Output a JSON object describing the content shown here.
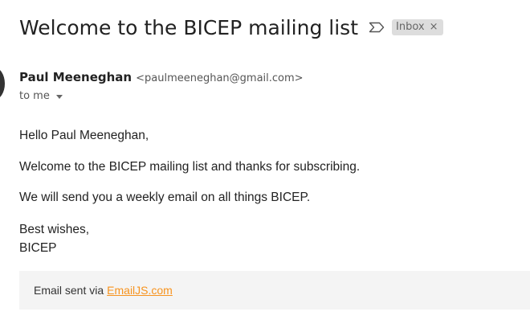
{
  "email": {
    "subject": "Welcome to the BICEP mailing list",
    "label_chip": "Inbox",
    "label_chip_close": "×",
    "sender": {
      "name": "Paul Meeneghan",
      "email": "<paulmeeneghan@gmail.com>"
    },
    "recipient_text": "to me",
    "body": {
      "greeting": "Hello Paul Meeneghan,",
      "line1": "Welcome to the BICEP mailing list and thanks for subscribing.",
      "line2": "We will send you a weekly email on all things BICEP.",
      "signoff_line1": "Best wishes,",
      "signoff_line2": "BICEP"
    },
    "footer": {
      "text": "Email sent via",
      "link_text": "EmailJS.com",
      "link_color": "#f7931e"
    }
  },
  "icons": {
    "important_marker": "important-marker-icon",
    "chip_close": "close-icon",
    "recipient_caret": "chevron-down-icon"
  },
  "colors": {
    "chip_background": "#dddddd",
    "footer_background": "#f4f4f4",
    "text": "#222222"
  }
}
